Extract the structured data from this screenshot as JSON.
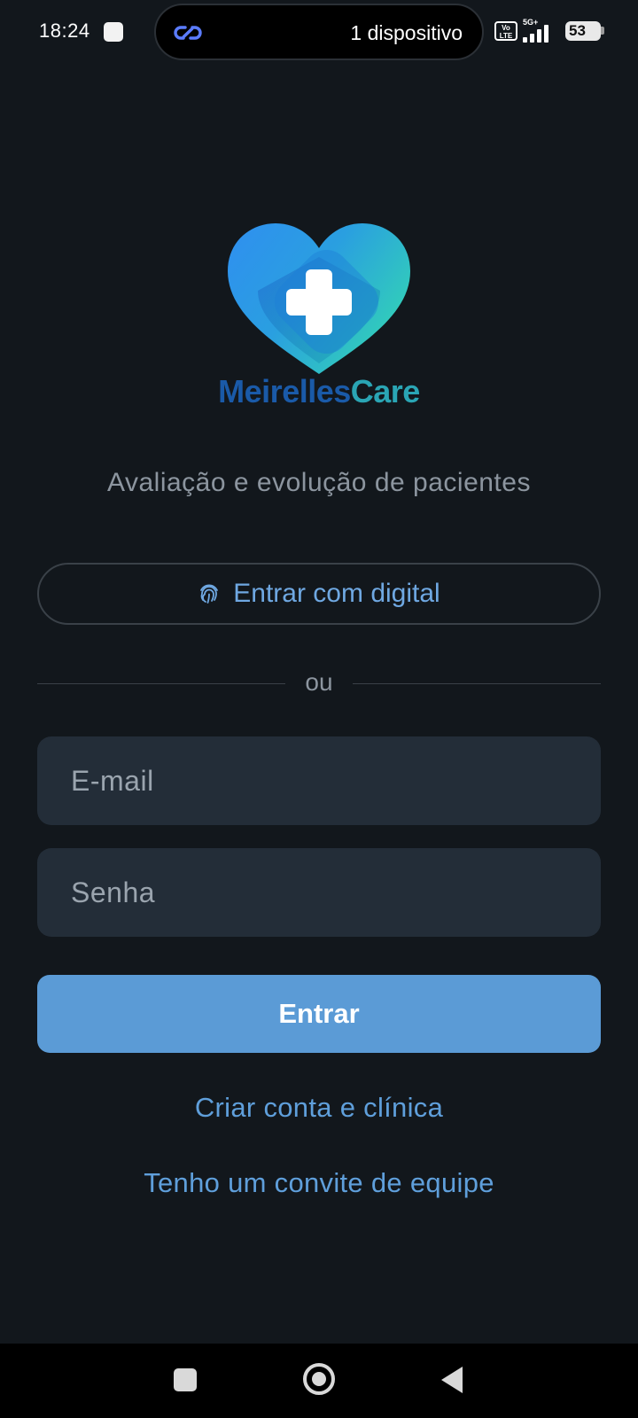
{
  "status_bar": {
    "time": "18:24",
    "devices_label": "1 dispositivo",
    "volte_label": "Vo LTE",
    "network_type": "5G+",
    "battery": "53"
  },
  "brand": {
    "name_part1": "Meirelles",
    "name_part2": "Care",
    "color_primary": "#1a5aa8",
    "color_secondary": "#2aa5b4"
  },
  "subtitle": "Avaliação e evolução de pacientes",
  "biometric": {
    "label": "Entrar com digital",
    "icon": "fingerprint-icon"
  },
  "divider_label": "ou",
  "form": {
    "email_placeholder": "E-mail",
    "email_value": "",
    "password_placeholder": "Senha",
    "password_value": "",
    "submit_label": "Entrar"
  },
  "links": {
    "create_account": "Criar conta e clínica",
    "team_invite": "Tenho um convite de equipe"
  },
  "colors": {
    "background": "#12171c",
    "accent": "#5b9bd6",
    "link": "#5f9fdb",
    "field_bg": "#232d38"
  }
}
